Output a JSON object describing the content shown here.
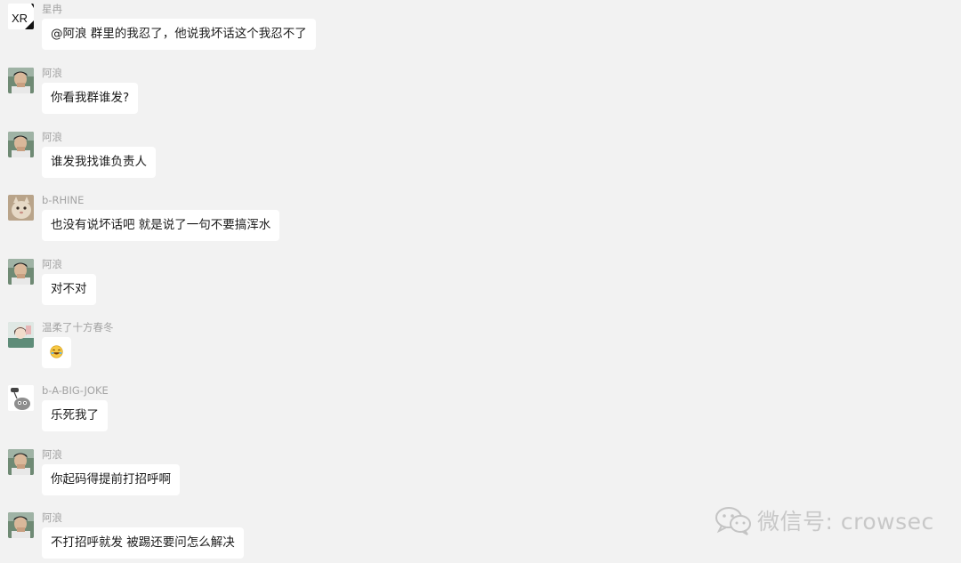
{
  "messages": [
    {
      "sender": "星冉",
      "avatar": "xr-logo-avatar",
      "avatar_text": "XR",
      "text": "@阿浪 群里的我忍了，他说我坏话这个我忍不了"
    },
    {
      "sender": "阿浪",
      "avatar": "photo-avatar",
      "text": "你看我群谁发?"
    },
    {
      "sender": "阿浪",
      "avatar": "photo-avatar",
      "text": "谁发我找谁负责人"
    },
    {
      "sender": "b-RHINE",
      "avatar": "cat-photo-avatar",
      "text": "也没有说坏话吧 就是说了一句不要搞浑水"
    },
    {
      "sender": "阿浪",
      "avatar": "photo-avatar",
      "text": "对不对"
    },
    {
      "sender": "温柔了十方春冬",
      "avatar": "anime-avatar",
      "text": "",
      "emoji": "laughing-emoji-icon"
    },
    {
      "sender": "b-A-BIG-JOKE",
      "avatar": "cartoon-avatar",
      "text": "乐死我了"
    },
    {
      "sender": "阿浪",
      "avatar": "photo-avatar",
      "text": "你起码得提前打招呼啊"
    },
    {
      "sender": "阿浪",
      "avatar": "photo-avatar",
      "text": "不打招呼就发 被踢还要问怎么解决"
    }
  ],
  "watermark": {
    "icon": "wechat-icon",
    "text": "微信号: crowsec"
  }
}
